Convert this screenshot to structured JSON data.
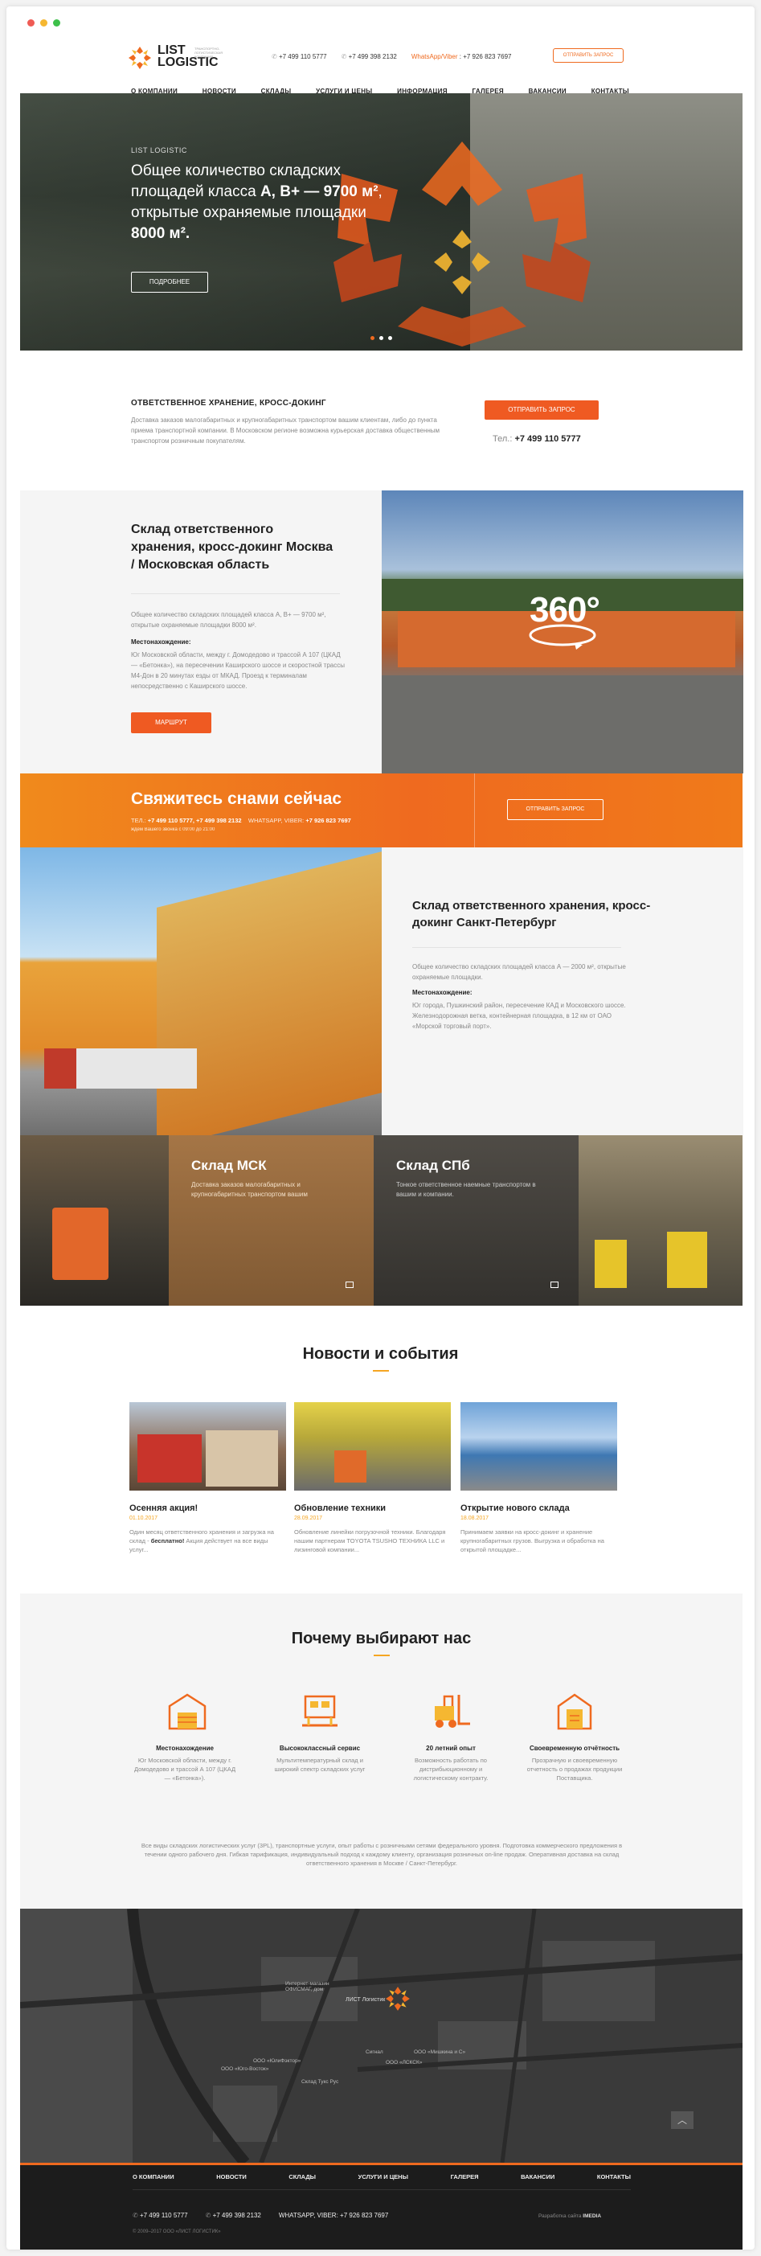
{
  "header": {
    "logo_line1": "LIST",
    "logo_line2": "LOGISTIC",
    "logo_tagline": "ТРАНСПОРТНО-ЛОГИСТИЧЕСКАЯ КОМПАНИЯ",
    "phone1": "+7 499 110 5777",
    "phone2": "+7 499 398 2132",
    "whatsapp_label": "WhatsApp/Viber",
    "phone3": "+7 926 823 7697",
    "request_button": "ОТПРАВИТЬ ЗАПРОС"
  },
  "nav": [
    "О КОМПАНИИ",
    "НОВОСТИ",
    "СКЛАДЫ",
    "УСЛУГИ И ЦЕНЫ",
    "ИНФОРМАЦИЯ",
    "ГАЛЕРЕЯ",
    "ВАКАНСИИ",
    "КОНТАКТЫ"
  ],
  "hero": {
    "kicker": "LIST LOGISTIC",
    "title_a": "Общее количество складских площадей класса ",
    "title_b": "А, В+ — 9700 м²",
    "title_c": ", открытые охраняемые площадки ",
    "title_d": "8000 м².",
    "button": "ПОДРОБНЕЕ"
  },
  "intro": {
    "title": "ОТВЕТСТВЕННОЕ ХРАНЕНИЕ, КРОСС-ДОКИНГ",
    "text": "Доставка заказов малогабаритных и крупногабаритных транспортом вашим клиентам, либо до пункта приема транспортной компании. В Московском регионе возможна курьерская доставка общественным транспортом розничным покупателям.",
    "button": "ОТПРАВИТЬ ЗАПРОС",
    "tel_label": "Тел.:",
    "tel": "+7 499 110 5777"
  },
  "moscow": {
    "title": "Склад ответственного хранения, кросс-докинг Москва / Московская область",
    "text": "Общее количество складских площадей класса А, В+ — 9700 м², открытые охраняемые площадки 8000 м².",
    "loc_label": "Местонахождение:",
    "loc_text": "Юг Московской области, между г. Домодедово и трассой А 107 (ЦКАД — «Бетонка»), на пересечении Каширского шоссе и скоростной трассы М4-Дон в 20 минутах езды от МКАД. Проезд к терминалам непосредственно с Каширского шоссе.",
    "button": "МАРШРУТ",
    "badge": "360°"
  },
  "contact_band": {
    "title": "Свяжитесь снами сейчас",
    "tel_label": "ТЕЛ.:",
    "phones": "+7 499 110 5777, +7 499 398 2132",
    "wa_label": "WHATSAPP, VIBER:",
    "wa_phone": "+7 926 823 7697",
    "hours": "ждем Вашего звонка с 09:00 до 21:00",
    "button": "ОТПРАВИТЬ ЗАПРОС"
  },
  "spb": {
    "title": "Склад ответственного хранения, кросс-докинг Санкт-Петербург",
    "text": "Общее количество складских площадей класса А — 2000 м², открытые охраняемые площадки.",
    "loc_label": "Местонахождение:",
    "loc_text": "Юг города, Пушкинский район, пересечение КАД и Московского шоссе. Железнодорожная ветка, контейнерная площадка, в 12 км от ОАО «Морской торговый порт»."
  },
  "tiles": [
    {
      "title": "Склад МСК",
      "text": "Доставка заказов малогабаритных и крупногабаритных транспортом вашим"
    },
    {
      "title": "Склад СПб",
      "text": "Тонкое ответственное наемные транспортом в вашим и компании."
    }
  ],
  "news": {
    "heading": "Новости и события",
    "items": [
      {
        "title": "Осенняя акция!",
        "date": "01.10.2017",
        "text_a": "Один месяц ответственного хранения и загрузка на склад - ",
        "text_b": "бесплатно!",
        "text_c": " Акция действует на все виды услуг..."
      },
      {
        "title": "Обновление техники",
        "date": "28.09.2017",
        "text_a": "Обновление линейки погрузочной техники. Благодаря нашим партнерам TOYOTA TSUSHO ТЕХНИКА LLC и лизинговой компании...",
        "text_b": "",
        "text_c": ""
      },
      {
        "title": "Открытие нового склада",
        "date": "18.08.2017",
        "text_a": "Принимаем заявки на кросс-докинг и хранение крупногабаритных грузов. Выгрузка и обработка на открытой площадке...",
        "text_b": "",
        "text_c": ""
      }
    ]
  },
  "why": {
    "heading": "Почему выбирают нас",
    "items": [
      {
        "title": "Местонахождение",
        "text": "Юг Московской области, между г. Домодедово и трассой А 107 (ЦКАД — «Бетонка»)."
      },
      {
        "title": "Высококлассный сервис",
        "text": "Мультитемпературный склад и широкий спектр складских услуг"
      },
      {
        "title": "20 летний опыт",
        "text": "Возможность работать по дистрибьюционному и логистическому контракту."
      },
      {
        "title": "Своевременную отчётность",
        "text": "Прозрачную и своевременную отчетность о продажах продукции Поставщика."
      }
    ],
    "footnote": "Все виды складских логистических услуг (3PL), транспортные услуги, опыт работы с розничными сетями федерального уровня. Подготовка коммерческого предложения в течении одного рабочего дня. Гибкая тарификация, индивидуальный подход к каждому клиенту, организация розничных on-line продаж. Оперативная доставка на склад ответственного хранения в Москве / Санкт-Петербург."
  },
  "map": {
    "pin_label": "ЛИСТ Логистик",
    "labels": [
      "Интернет-магазин ОФИСМАГ, дом",
      "Сигнал",
      "ООО «ЛСКСК»",
      "ООО «Мишкина и С»",
      "ООО «ЮлиФэктор»",
      "ООО «Юго-Восток»",
      "Склад Тукс Рус"
    ]
  },
  "footer": {
    "nav": [
      "О КОМПАНИИ",
      "НОВОСТИ",
      "СКЛАДЫ",
      "УСЛУГИ И ЦЕНЫ",
      "ГАЛЕРЕЯ",
      "ВАКАНСИИ",
      "КОНТАКТЫ"
    ],
    "phone1": "+7 499 110 5777",
    "phone2": "+7 499 398 2132",
    "wa": "WHATSAPP, VIBER:",
    "phone3": "+7 926 823 7697",
    "dev_label": "Разработка сайта",
    "dev_name": "IMEDIA",
    "copyright": "© 2009–2017 ООО «ЛИСТ ЛОГИСТИК»"
  }
}
